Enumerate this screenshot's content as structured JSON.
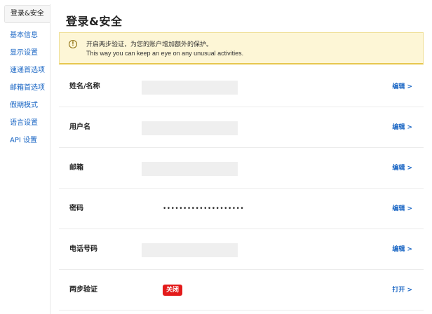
{
  "sidebar": {
    "items": [
      {
        "label": "登录&安全",
        "active": true
      },
      {
        "label": "基本信息"
      },
      {
        "label": "显示设置"
      },
      {
        "label": "速递首选项"
      },
      {
        "label": "邮箱首选项"
      },
      {
        "label": "假期模式"
      },
      {
        "label": "语言设置"
      },
      {
        "label": "API 设置"
      }
    ]
  },
  "header": {
    "title": "登录&安全"
  },
  "alert": {
    "icon": "warning-circle-icon",
    "line1": "开启两步验证，为您的账户增加额外的保护。",
    "line2": "This way you can keep an eye on any unusual activities."
  },
  "rows": [
    {
      "label": "姓名/名称",
      "action": "编辑 >"
    },
    {
      "label": "用户名",
      "action": "编辑 >"
    },
    {
      "label": "邮箱",
      "action": "编辑 >"
    },
    {
      "label": "密码",
      "value": "••••••••••••••••••••",
      "action": "编辑 >"
    },
    {
      "label": "电话号码",
      "action": "编辑 >"
    },
    {
      "label": "两步验证",
      "badge": "关闭",
      "action": "打开 >"
    }
  ],
  "colors": {
    "link": "#1a66c4",
    "alert_bg": "#fdf6d6",
    "alert_border": "#e7c74e",
    "badge_red": "#e31b1b"
  }
}
